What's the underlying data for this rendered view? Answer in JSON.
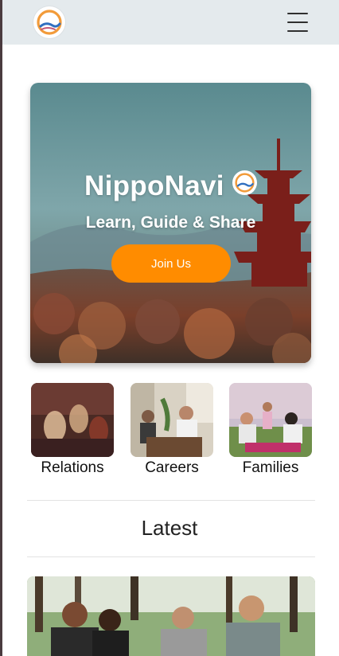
{
  "header": {
    "logo_icon": "nipponavi-logo-icon",
    "menu_icon": "hamburger-menu-icon"
  },
  "hero": {
    "title": "NippoNavi",
    "subtitle": "Learn, Guide & Share",
    "cta_label": "Join Us"
  },
  "categories": [
    {
      "label": "Relations"
    },
    {
      "label": "Careers"
    },
    {
      "label": "Families"
    }
  ],
  "latest": {
    "heading": "Latest"
  },
  "colors": {
    "accent": "#ff8c00",
    "header_bg": "#e4eaed"
  }
}
